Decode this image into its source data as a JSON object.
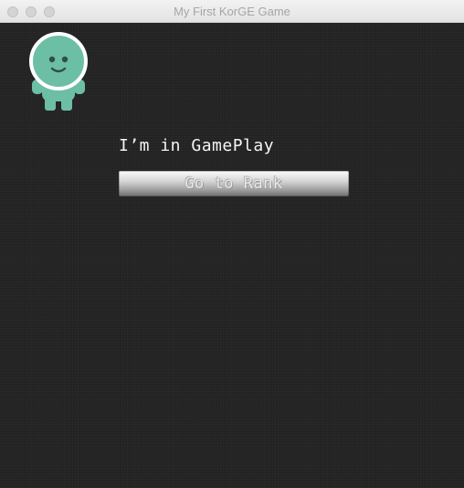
{
  "window": {
    "title": "My First KorGE Game"
  },
  "scene": {
    "label": "I’m in GamePlay",
    "button_label": "Go to Rank"
  },
  "colors": {
    "background": "#232323",
    "character": "#6cbfa5",
    "character_face": "#2f4f46",
    "ring": "#ffffff",
    "text": "#f4f4f4"
  },
  "icons": {
    "character": "green-alien-character",
    "close": "close-traffic-light",
    "minimize": "minimize-traffic-light",
    "maximize": "maximize-traffic-light"
  }
}
